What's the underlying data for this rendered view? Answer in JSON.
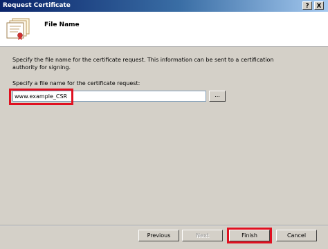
{
  "window": {
    "title": "Request Certificate",
    "help_glyph": "?",
    "close_glyph": "X"
  },
  "header": {
    "title": "File Name",
    "icon": "certificate-icon"
  },
  "main": {
    "description_line1": "Specify the file name for the certificate request. This information can be sent to a certification",
    "description_line2": "authority for signing.",
    "field_label": "Specify a file name for the certificate request:",
    "file_name_value": "www.example_CSR",
    "browse_label": "..."
  },
  "buttons": {
    "previous": "Previous",
    "next": "Next",
    "finish": "Finish",
    "cancel": "Cancel"
  },
  "colors": {
    "highlight": "#e01020",
    "title_gradient_start": "#0a246a"
  }
}
